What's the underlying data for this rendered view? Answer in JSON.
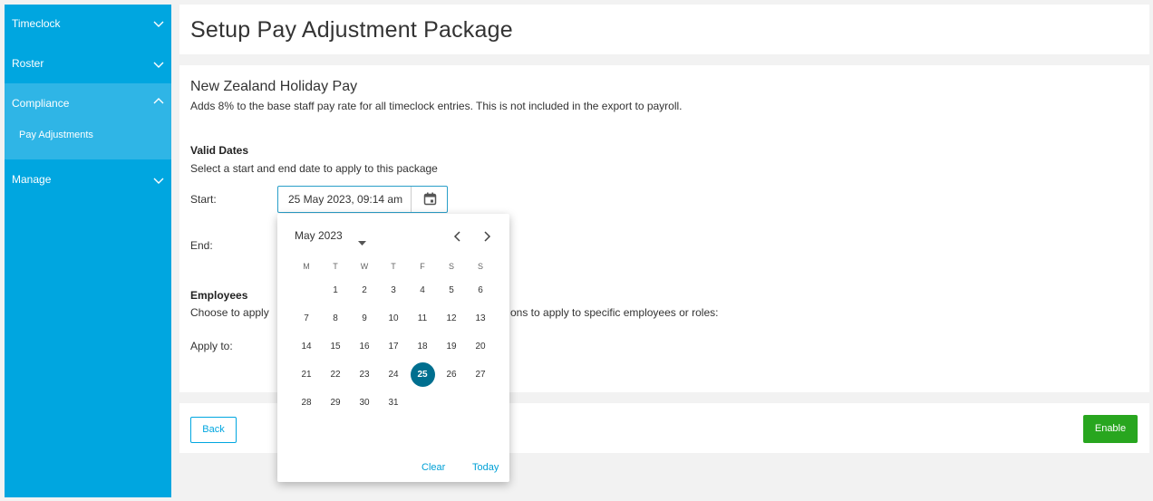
{
  "sidebar": {
    "items": [
      {
        "label": "Timeclock"
      },
      {
        "label": "Roster"
      },
      {
        "label": "Compliance",
        "sub": "Pay Adjustments"
      },
      {
        "label": "Manage"
      }
    ]
  },
  "page": {
    "title": "Setup Pay Adjustment Package"
  },
  "package": {
    "name": "New Zealand Holiday Pay",
    "description": "Adds 8% to the base staff pay rate for all timeclock entries. This is not included in the export to payroll."
  },
  "valid_dates": {
    "heading": "Valid Dates",
    "text": "Select a start and end date to apply to this package",
    "start_label": "Start:",
    "start_value": "25 May 2023, 09:14 am",
    "end_label": "End:"
  },
  "employees": {
    "heading": "Employees",
    "text_left": "Choose to apply",
    "text_right": "ons to apply to specific employees or roles:",
    "apply_label": "Apply to:"
  },
  "footer": {
    "back_label": "Back",
    "enable_label": "Enable"
  },
  "calendar": {
    "month_label": "May 2023",
    "weekdays": [
      "M",
      "T",
      "W",
      "T",
      "F",
      "S",
      "S"
    ],
    "weeks": [
      [
        "",
        "1",
        "2",
        "3",
        "4",
        "5",
        "6"
      ],
      [
        "7",
        "8",
        "9",
        "10",
        "11",
        "12",
        "13"
      ],
      [
        "14",
        "15",
        "16",
        "17",
        "18",
        "19",
        "20"
      ],
      [
        "21",
        "22",
        "23",
        "24",
        "25",
        "26",
        "27"
      ],
      [
        "28",
        "29",
        "30",
        "31",
        "",
        "",
        ""
      ]
    ],
    "selected_day": "25",
    "clear_label": "Clear",
    "today_label": "Today"
  },
  "colors": {
    "sidebar": "#00a6e0",
    "sidebar_active": "#2fb5e6",
    "selected_day": "#006f8f",
    "enable_button": "#28a61f",
    "link": "#00a0d6"
  }
}
